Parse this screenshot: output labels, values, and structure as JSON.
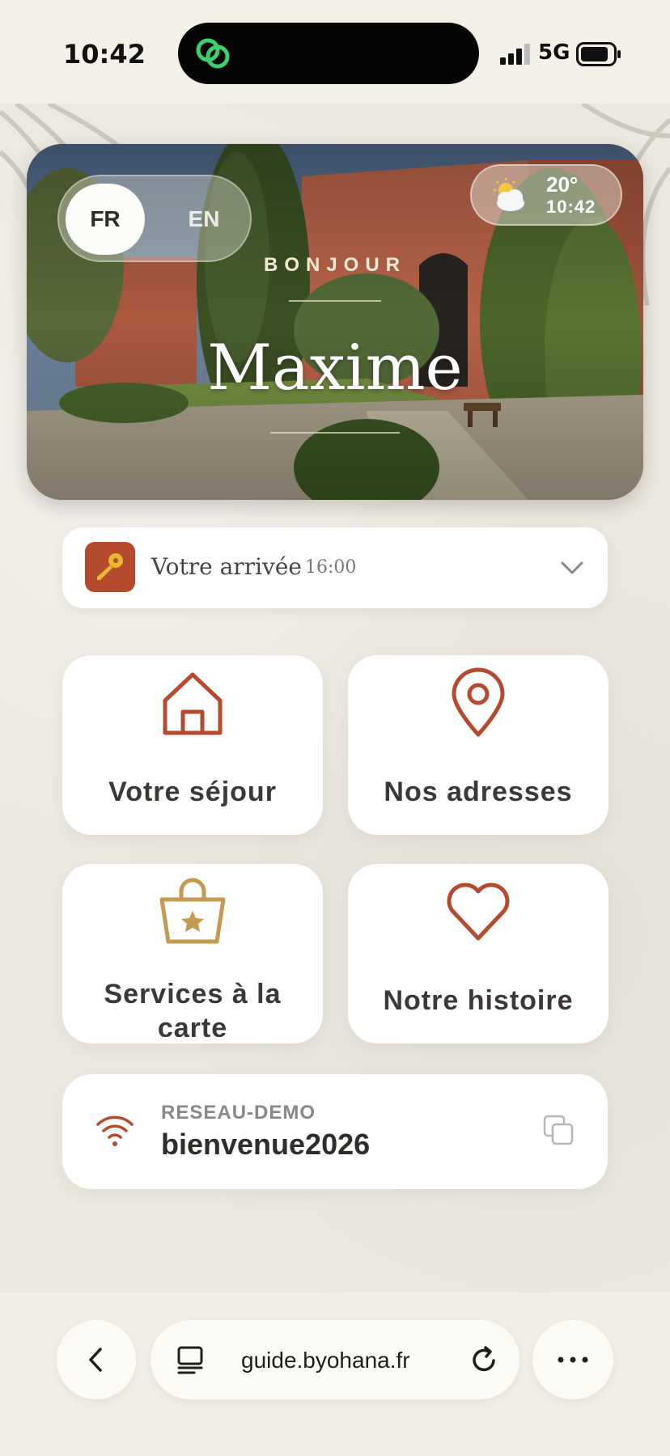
{
  "status_bar": {
    "time": "10:42",
    "network": "5G"
  },
  "hero": {
    "lang_options": [
      "FR",
      "EN"
    ],
    "selected_lang": "FR",
    "weather": {
      "icon": "partly-cloudy-icon",
      "temp": "20°",
      "time": "10:42"
    },
    "greeting": "BONJOUR",
    "guest_name": "Maxime"
  },
  "arrival": {
    "icon": "key-icon",
    "label": "Votre arrivée",
    "time": "16:00"
  },
  "tiles": [
    {
      "label": "Votre séjour",
      "icon": "home-icon"
    },
    {
      "label": "Nos adresses",
      "icon": "map-pin-icon"
    },
    {
      "label_line1": "Services à la",
      "label_line2": "carte",
      "icon": "shopping-bag-star-icon"
    },
    {
      "label": "Notre histoire",
      "icon": "heart-icon"
    }
  ],
  "wifi": {
    "network_name": "RESEAU-DEMO",
    "password": "bienvenue2026"
  },
  "browser": {
    "url": "guide.byohana.fr"
  },
  "colors": {
    "accent": "#b54a2e",
    "gold": "#c49a52",
    "background": "#ece8df"
  }
}
